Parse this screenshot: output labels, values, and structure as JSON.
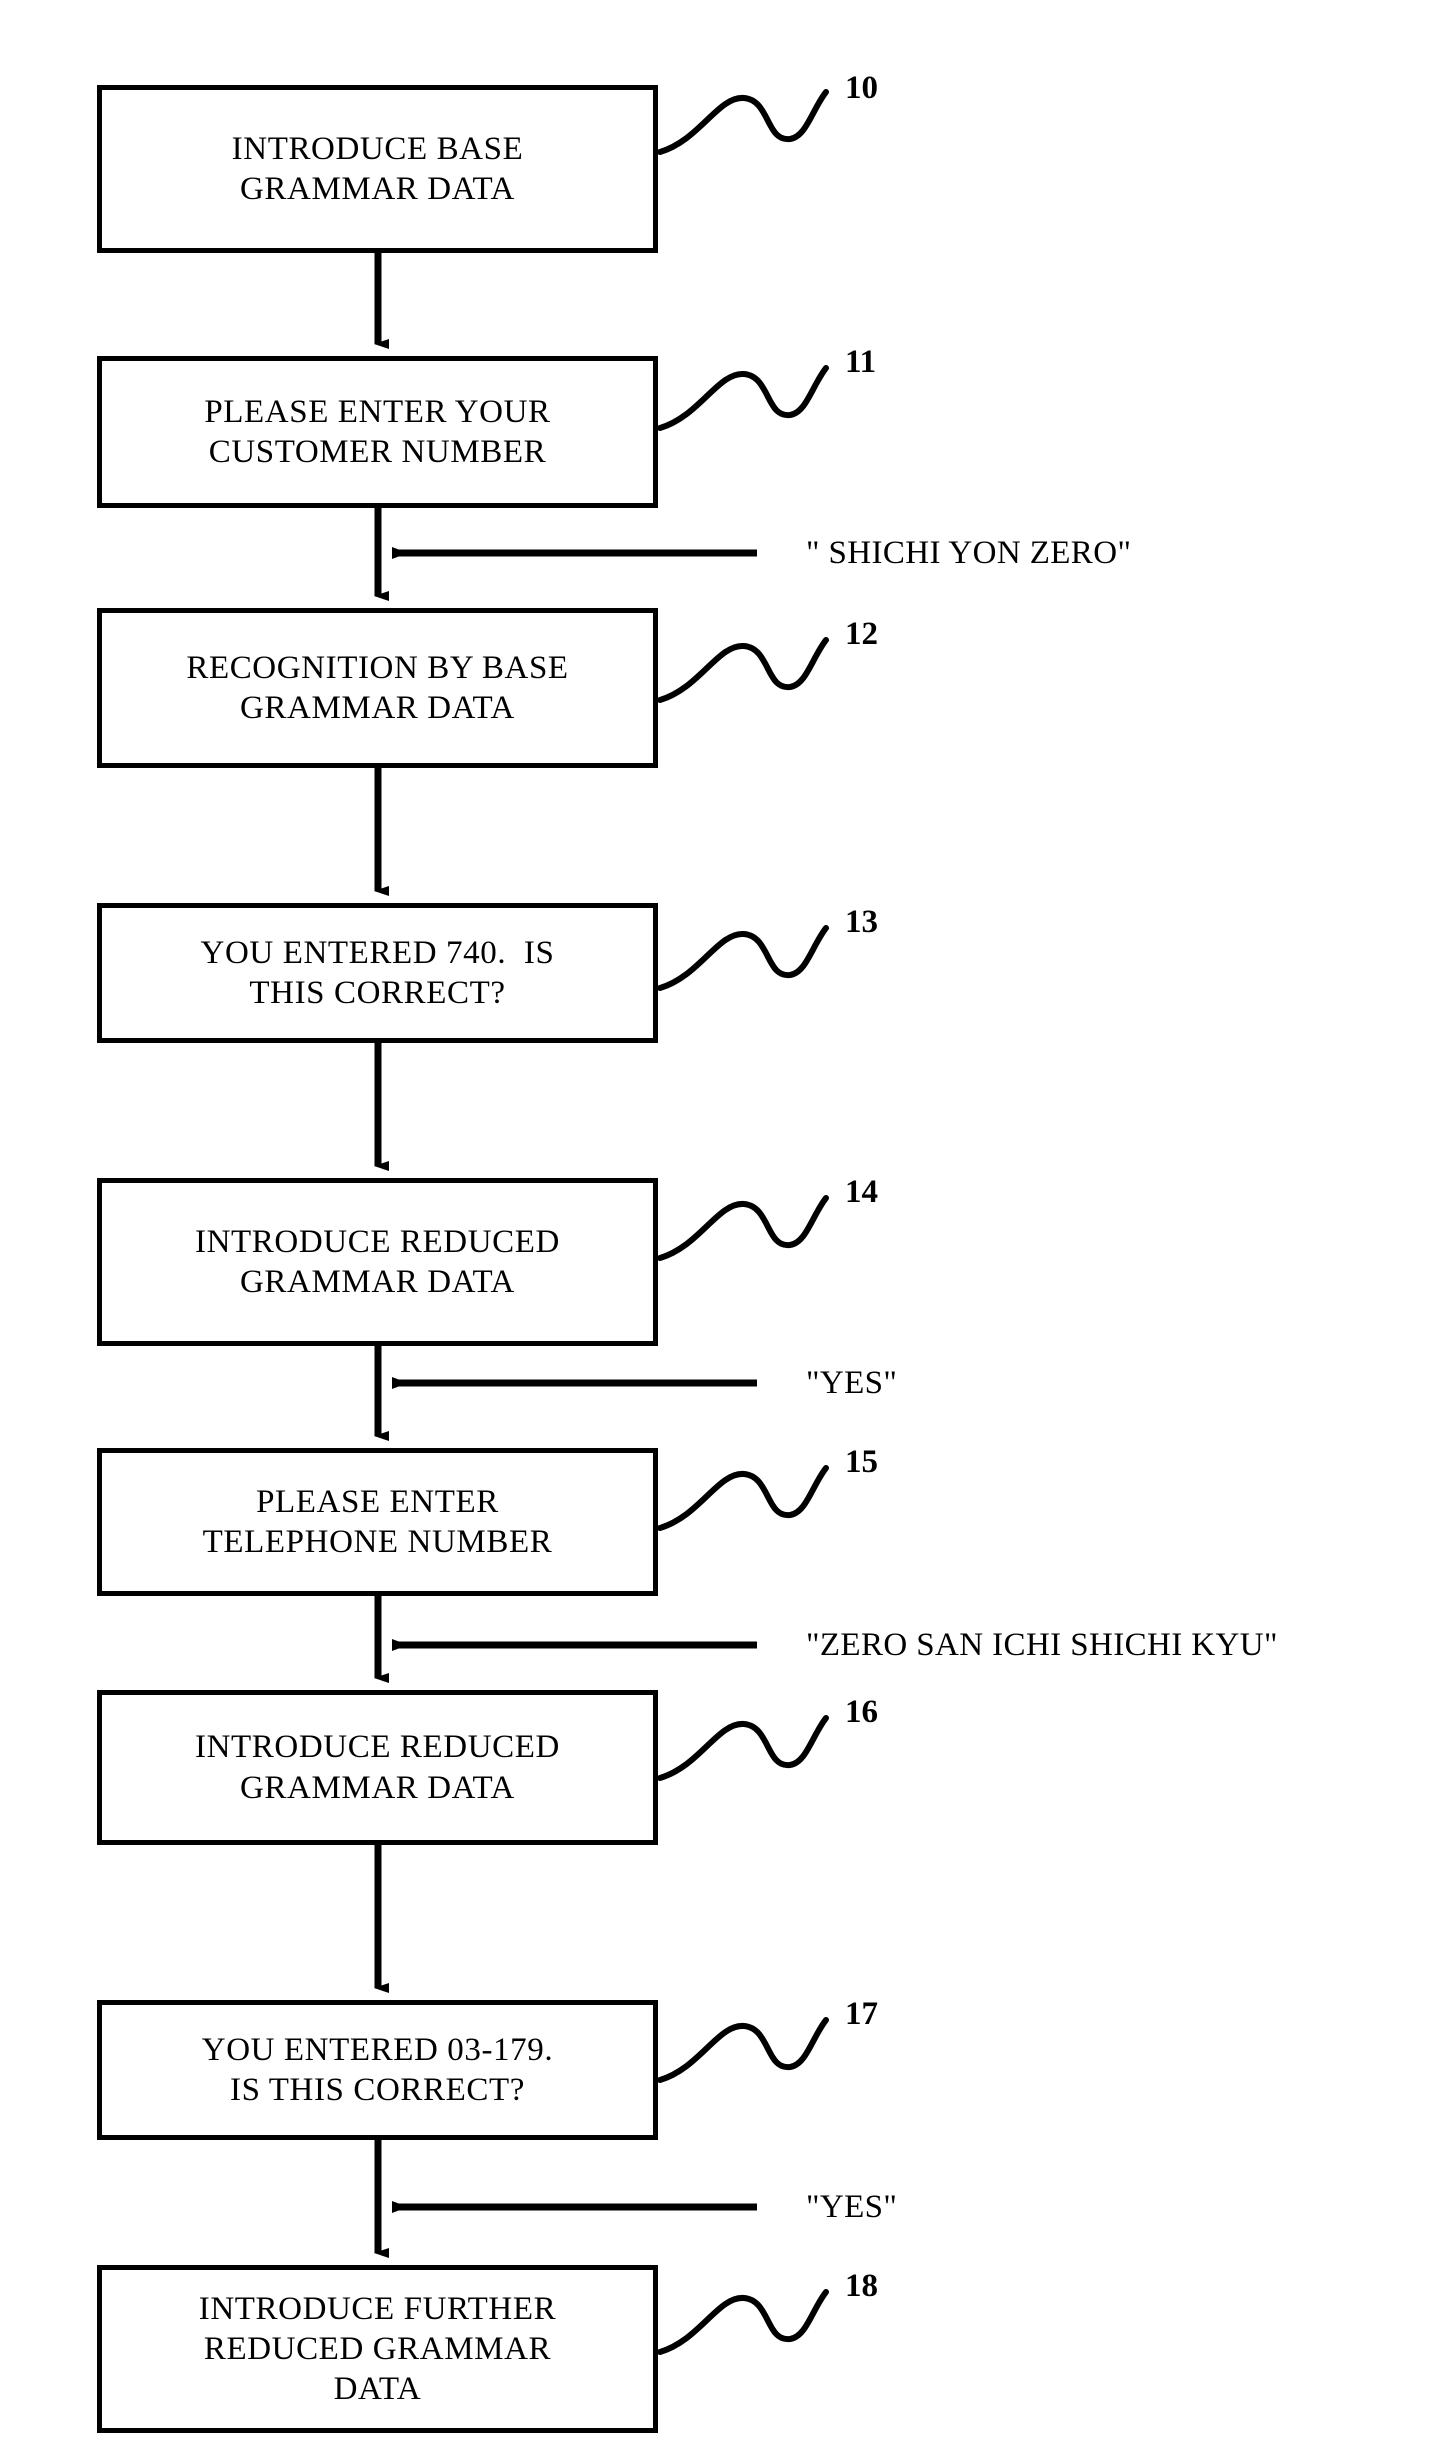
{
  "diagram": {
    "type": "patent-flowchart",
    "orientation": "vertical",
    "nodes": [
      {
        "ref": "10",
        "lines": [
          "INTRODUCE BASE",
          "GRAMMAR DATA"
        ]
      },
      {
        "ref": "11",
        "lines": [
          "PLEASE ENTER YOUR",
          "CUSTOMER NUMBER"
        ]
      },
      {
        "ref": "12",
        "lines": [
          "RECOGNITION BY BASE",
          "GRAMMAR DATA"
        ]
      },
      {
        "ref": "13",
        "lines": [
          "YOU ENTERED 740.  IS",
          "THIS CORRECT?"
        ]
      },
      {
        "ref": "14",
        "lines": [
          "INTRODUCE REDUCED",
          "GRAMMAR DATA"
        ]
      },
      {
        "ref": "15",
        "lines": [
          "PLEASE ENTER",
          "TELEPHONE NUMBER"
        ]
      },
      {
        "ref": "16",
        "lines": [
          "INTRODUCE REDUCED",
          "GRAMMAR DATA"
        ]
      },
      {
        "ref": "17",
        "lines": [
          "YOU ENTERED 03-179.",
          "IS THIS CORRECT?"
        ]
      },
      {
        "ref": "18",
        "lines": [
          "INTRODUCE FURTHER",
          "REDUCED GRAMMAR",
          "DATA"
        ]
      }
    ],
    "utterances": [
      {
        "id": "u1",
        "text": "\" SHICHI YON ZERO\""
      },
      {
        "id": "u2",
        "text": "\"YES\""
      },
      {
        "id": "u3",
        "text": "\"ZERO SAN ICHI SHICHI KYU\""
      },
      {
        "id": "u4",
        "text": "\"YES\""
      }
    ],
    "colors": {
      "ink": "#000000",
      "paper": "#ffffff"
    }
  }
}
